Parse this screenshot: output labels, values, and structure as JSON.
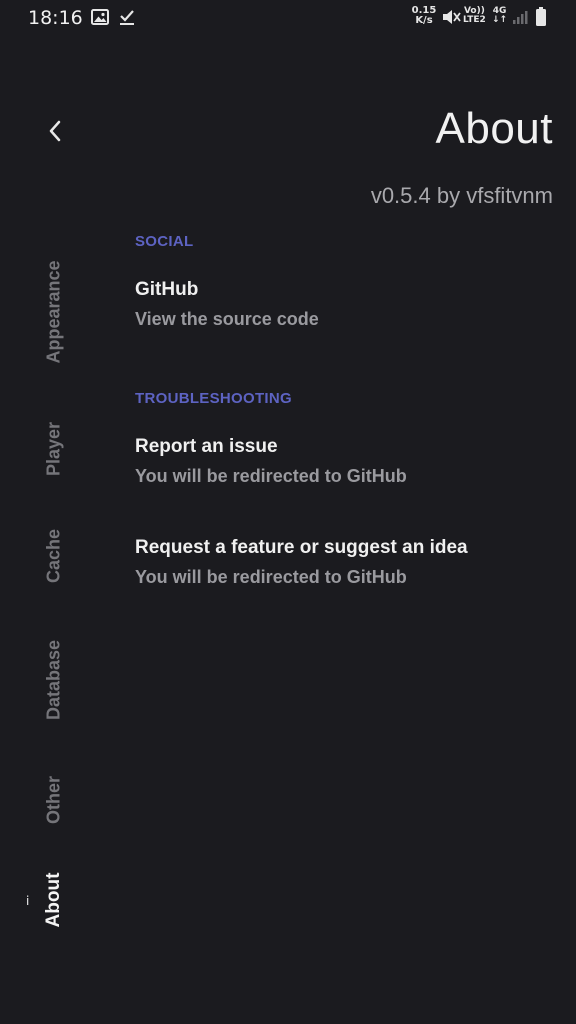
{
  "status_bar": {
    "time": "18:16",
    "net_speed_value": "0.15",
    "net_speed_unit": "K/s",
    "volte_top": "Vo))",
    "volte_bottom": "LTE2",
    "network_type": "4G"
  },
  "header": {
    "title": "About",
    "version": "v0.5.4 by vfsfitvnm"
  },
  "sidebar": {
    "tabs": [
      {
        "label": "Appearance",
        "active": false
      },
      {
        "label": "Player",
        "active": false
      },
      {
        "label": "Cache",
        "active": false
      },
      {
        "label": "Database",
        "active": false
      },
      {
        "label": "Other",
        "active": false
      },
      {
        "label": "About",
        "active": true
      }
    ],
    "active_icon_glyph": "i"
  },
  "sections": {
    "social": {
      "header": "SOCIAL",
      "github": {
        "title": "GitHub",
        "subtitle": "View the source code"
      }
    },
    "troubleshooting": {
      "header": "TROUBLESHOOTING",
      "report": {
        "title": "Report an issue",
        "subtitle": "You will be redirected to GitHub"
      },
      "request": {
        "title": "Request a feature or suggest an idea",
        "subtitle": "You will be redirected to GitHub"
      }
    }
  },
  "colors": {
    "background": "#1b1b1f",
    "accent": "#5d63c2",
    "text_primary": "#f0f0f0",
    "text_secondary": "#9a9a9f",
    "tab_inactive": "#75757a"
  }
}
